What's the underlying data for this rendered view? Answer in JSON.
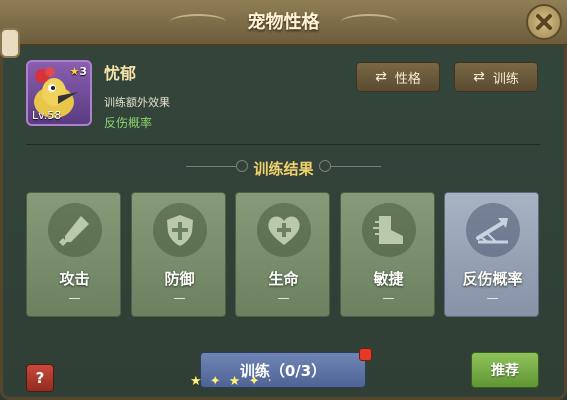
{
  "window": {
    "title": "宠物性格"
  },
  "pet": {
    "name": "忧郁",
    "stars": "3",
    "level": "Lv.58",
    "bonus_label": "训练额外效果",
    "bonus_value": "反伤概率"
  },
  "buttons": {
    "personality": "性格",
    "train": "训练",
    "help": "?",
    "train_main": "训练（0/3）",
    "recommend": "推荐"
  },
  "section": {
    "title": "训练结果"
  },
  "results": [
    {
      "label": "攻击",
      "value": "—",
      "icon": "sword-icon"
    },
    {
      "label": "防御",
      "value": "—",
      "icon": "shield-icon"
    },
    {
      "label": "生命",
      "value": "—",
      "icon": "heart-plus-icon"
    },
    {
      "label": "敏捷",
      "value": "—",
      "icon": "boot-icon"
    },
    {
      "label": "反伤概率",
      "value": "—",
      "icon": "reflect-arrow-icon"
    }
  ],
  "colors": {
    "title_text": "#fff4d4",
    "section_title": "#f1d26a",
    "bonus_value": "#8ed16d",
    "card_green": "#869b78",
    "card_highlight": "#a8b3c4",
    "train_button": "#6f86b6",
    "recommend_button": "#8fc35b",
    "help_button": "#c94a3a"
  }
}
